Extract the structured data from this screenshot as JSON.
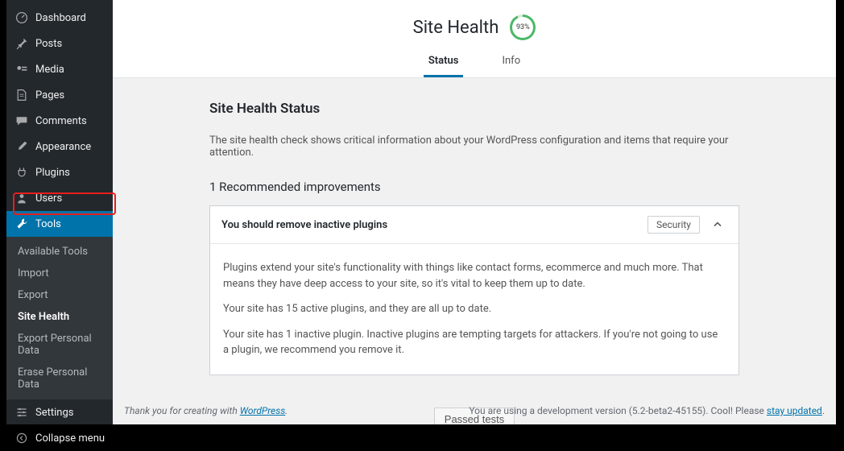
{
  "sidebar": {
    "items": [
      {
        "label": "Dashboard",
        "icon": "dashboard"
      },
      {
        "label": "Posts",
        "icon": "pin"
      },
      {
        "label": "Media",
        "icon": "media"
      },
      {
        "label": "Pages",
        "icon": "pages"
      },
      {
        "label": "Comments",
        "icon": "comments"
      },
      {
        "label": "Appearance",
        "icon": "brush"
      },
      {
        "label": "Plugins",
        "icon": "plug"
      },
      {
        "label": "Users",
        "icon": "user"
      },
      {
        "label": "Tools",
        "icon": "wrench"
      },
      {
        "label": "Settings",
        "icon": "sliders"
      },
      {
        "label": "Collapse menu",
        "icon": "collapse"
      }
    ],
    "submenu": [
      "Available Tools",
      "Import",
      "Export",
      "Site Health",
      "Export Personal Data",
      "Erase Personal Data"
    ]
  },
  "header": {
    "title": "Site Health",
    "score": "93%",
    "tabs": {
      "status": "Status",
      "info": "Info"
    }
  },
  "content": {
    "section_title": "Site Health Status",
    "intro": "The site health check shows critical information about your WordPress configuration and items that require your attention.",
    "improvements_title": "1 Recommended improvements",
    "item_title": "You should remove inactive plugins",
    "badge": "Security",
    "body_p1": "Plugins extend your site's functionality with things like contact forms, ecommerce and much more. That means they have deep access to your site, so it's vital to keep them up to date.",
    "body_p2": "Your site has 15 active plugins, and they are all up to date.",
    "body_p3": "Your site has 1 inactive plugin. Inactive plugins are tempting targets for attackers. If you're not going to use a plugin, we recommend you remove it.",
    "passed_btn": "Passed tests"
  },
  "footer": {
    "left_text": "Thank you for creating with ",
    "left_link": "WordPress",
    "left_suffix": ".",
    "right_text": "You are using a development version (5.2-beta2-45155). Cool! Please ",
    "right_link": "stay updated",
    "right_suffix": "."
  }
}
